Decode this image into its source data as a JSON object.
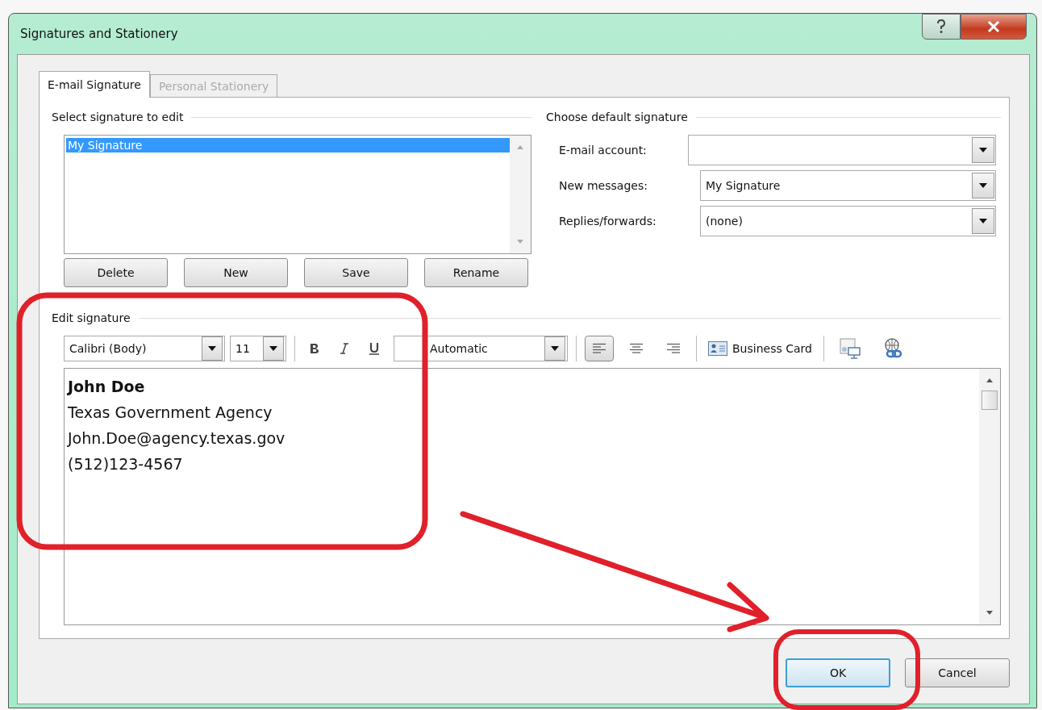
{
  "window": {
    "title": "Signatures and Stationery"
  },
  "tabs": [
    {
      "label": "E-mail Signature",
      "selected": true,
      "disabled": false
    },
    {
      "label": "Personal Stationery",
      "selected": false,
      "disabled": true
    }
  ],
  "select_signature": {
    "heading": "Select signature to edit",
    "items": [
      {
        "label": "My Signature",
        "selected": true
      }
    ],
    "buttons": [
      "Delete",
      "New",
      "Save",
      "Rename"
    ]
  },
  "default_signature": {
    "heading": "Choose default signature",
    "fields": [
      {
        "label": "E-mail account:"
      },
      {
        "label": "New messages:",
        "value": "My Signature"
      },
      {
        "label": "Replies/forwards:",
        "value": "(none)"
      }
    ]
  },
  "edit_signature": {
    "heading": "Edit signature",
    "toolbar": {
      "font": "Calibri (Body)",
      "size": "11",
      "font_color_name": "Automatic",
      "alignments": [
        {
          "kind": "left",
          "selected": true
        },
        {
          "kind": "center",
          "selected": false
        },
        {
          "kind": "right",
          "selected": false
        }
      ],
      "business_card": "Business Card"
    },
    "lines": [
      {
        "text": "John Doe",
        "bold": true
      },
      {
        "text": "Texas Government Agency",
        "bold": false
      },
      {
        "text": "John.Doe@agency.texas.gov",
        "bold": false
      },
      {
        "text": "(512)123-4567",
        "bold": false
      }
    ]
  },
  "footer_buttons": [
    {
      "label": "OK",
      "default": true
    },
    {
      "label": "Cancel",
      "default": false
    }
  ]
}
